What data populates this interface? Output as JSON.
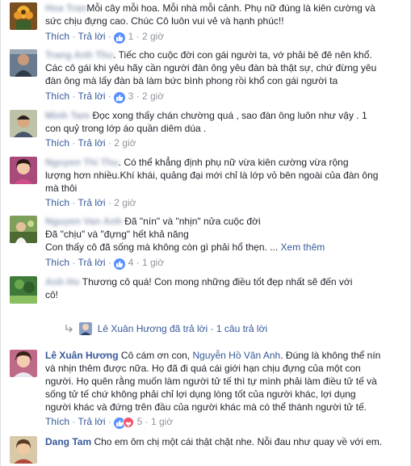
{
  "actions": {
    "like": "Thích",
    "reply": "Trả lời",
    "see_more": "Xem thêm",
    "separator": "·"
  },
  "comments": [
    {
      "name": "",
      "lines": [
        "Mỗi cây mỗi hoa. Mỗi nhà mỗi cảnh. Phụ nữ đúng là kiên cường và",
        "sức chịu đựng cao. Chúc Cô luôn vui vẻ và hạnh phúc!!"
      ],
      "likes": "1",
      "time": "2 giờ"
    },
    {
      "name": "",
      "lines": [
        "Tiếc cho cuộc đời con gái người ta, vớ phải bê đê nên khổ.",
        "Các cô gái khi yêu hãy cần người đàn ông yêu đàn bà thật sự, chứ đừng yêu",
        "đàn ông mà lấy đàn bà làm bức bình phong rồi khổ con gái người ta"
      ],
      "likes": "3",
      "time": "2 giờ"
    },
    {
      "name": "",
      "lines": [
        "Đọc xong thấy chán chường quá , sao đàn ông luôn như vậy . 1",
        "con quỷ trong lớp áo quần diêm dúa ."
      ],
      "likes": "",
      "time": "2 giờ"
    },
    {
      "name": "",
      "lines": ". Có thể khẳng định phụ nữ vừa kiên cường vừa rộng|lượng hơn nhiều.Khí khái, quảng đại mới chỉ là lớp vỏ bên ngoài của đàn ông|mà thôi",
      "likes": "",
      "time": "2 giờ"
    },
    {
      "name": "",
      "lines": [
        "Đã \"nín\" và \"nhịn\" nửa cuộc đời",
        "Đã \"chịu\" và \"đựng\" hết khả năng",
        "Con thấy cô đã sống mà không còn gì phải hổ thẹn. ..."
      ],
      "likes": "4",
      "time": "1 giờ"
    },
    {
      "name": "",
      "lines": [
        "Thương cô quá! Con mong những điều tốt đẹp nhất sẽ đến với",
        "cô!"
      ],
      "likes": "",
      "time": "2 giờ",
      "reply_summary": {
        "who": "Lê Xuân Hương đã trả lời",
        "count": "1 câu trả lời"
      }
    },
    {
      "name": "Lê Xuân Hương",
      "mention": "Nguyễn Hồ Vân Anh",
      "lines_first": "Cô cám ơn con, ",
      "lines_first_rest": ". Đúng là không thể nín",
      "lines": [
        "và nhịn thêm được nữa. Họ đã đi quá cái giới hạn chịu đựng của một con",
        "người. Họ quên rằng muốn làm người tử tế thì tự mình phải làm điều tử tế và",
        "sống tử tế chứ không phải chỉ lợi dụng lòng tốt của người khác, lợi dụng",
        "người khác và đứng trên đầu của người khác mà có thể thành người tử tế."
      ],
      "likes": "5",
      "time": "1 giờ"
    },
    {
      "name": "Dang Tam",
      "lines": [
        "Cho em ôm chị một cái thật chặt nhe. Nỗi đau như quay về với em."
      ],
      "likes": "",
      "time": ""
    }
  ],
  "colors": {
    "link": "#365899",
    "muted": "#90949c",
    "like": "#5890ff",
    "love": "#f25268"
  }
}
